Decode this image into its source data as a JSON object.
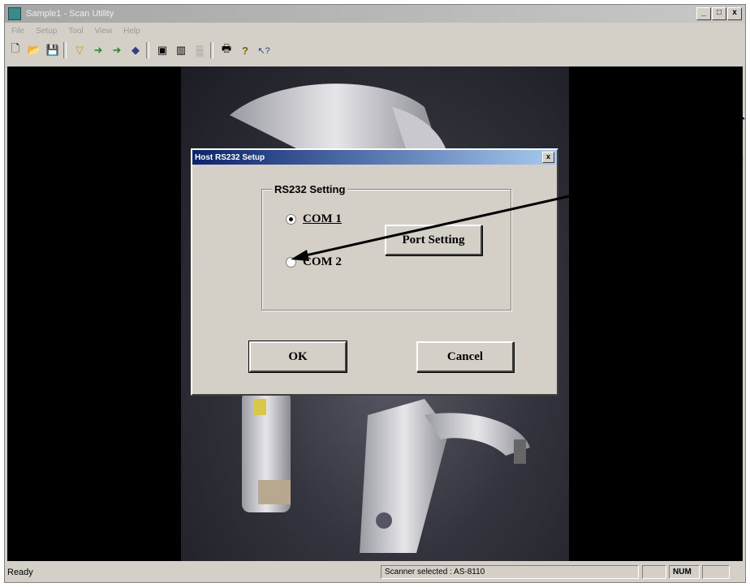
{
  "window": {
    "title": "Sample1 - Scan Utility",
    "buttons": [
      "_",
      "□",
      "x"
    ]
  },
  "menu": [
    "File",
    "Setup",
    "Tool",
    "View",
    "Help"
  ],
  "toolbar": {
    "items": [
      {
        "name": "new-file-icon",
        "glyph": "🗋"
      },
      {
        "name": "open-file-icon",
        "glyph": "📂"
      },
      {
        "name": "save-icon",
        "glyph": "💾"
      },
      {
        "name": "funnel-icon",
        "glyph": "▽"
      },
      {
        "name": "import-icon",
        "glyph": "➜"
      },
      {
        "name": "export-icon",
        "glyph": "➜"
      },
      {
        "name": "tag-icon",
        "glyph": "◆"
      },
      {
        "name": "picture-icon",
        "glyph": "▣"
      },
      {
        "name": "barcode-icon",
        "glyph": "▥"
      },
      {
        "name": "pattern-icon",
        "glyph": "▒"
      },
      {
        "name": "print-icon",
        "glyph": "🖶"
      },
      {
        "name": "help-icon",
        "glyph": "?"
      },
      {
        "name": "context-help-icon",
        "glyph": "↖?"
      }
    ]
  },
  "dialog": {
    "title": "Host RS232 Setup",
    "close": "x",
    "group_label": "RS232 Setting",
    "com1": "COM 1",
    "com2": "COM 2",
    "port_setting": "Port Setting",
    "ok": "OK",
    "cancel": "Cancel",
    "selected": "COM 1"
  },
  "status": {
    "ready": "Ready",
    "scanner": "Scanner selected : AS-8110",
    "num": "NUM"
  }
}
